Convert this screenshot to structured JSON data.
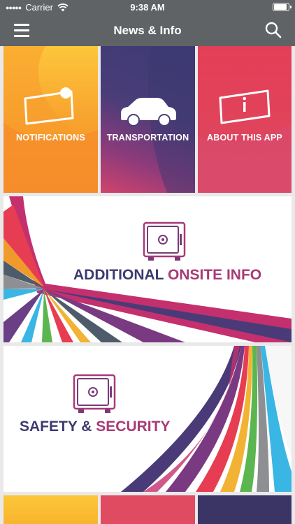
{
  "status_bar": {
    "carrier": "Carrier",
    "time": "9:38 AM",
    "battery_percent": 90
  },
  "nav": {
    "title": "News & Info",
    "menu_icon": "hamburger-menu-icon",
    "search_icon": "search-icon"
  },
  "tiles": [
    {
      "label": "NOTIFICATIONS",
      "icon": "notification-flag-icon",
      "color": "#f39a2b"
    },
    {
      "label": "TRANSPORTATION",
      "icon": "car-icon",
      "color": "#4b3f78"
    },
    {
      "label": "ABOUT THIS APP",
      "icon": "info-sign-icon",
      "color": "#e0435a"
    }
  ],
  "banners": [
    {
      "title_part1": "ADDITIONAL ",
      "title_part2": "ONSITE INFO",
      "icon": "safe-icon"
    },
    {
      "title_part1": "SAFETY & ",
      "title_part2": "SECURITY",
      "icon": "safe-icon"
    }
  ],
  "bottom_tiles": [
    {
      "color": "#f7b52e"
    },
    {
      "color": "#e14b62"
    },
    {
      "color": "#3b3566"
    }
  ]
}
